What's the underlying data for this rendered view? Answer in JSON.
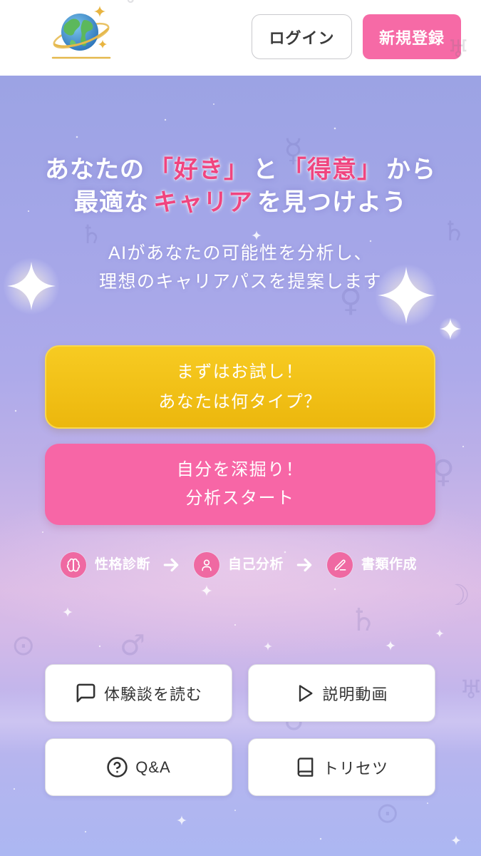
{
  "app": {
    "logo_icon": "globe-planet-logo-icon"
  },
  "header": {
    "login_label": "ログイン",
    "signup_label": "新規登録"
  },
  "hero": {
    "headline": {
      "line1": [
        {
          "text": "あなたの"
        },
        {
          "text": "「好き」"
        },
        {
          "text": "と"
        },
        {
          "text": "「得意」"
        },
        {
          "text": "から"
        }
      ],
      "line2": [
        {
          "text": "最適な"
        },
        {
          "text": "キャリア"
        },
        {
          "text": "を見つけよう"
        }
      ]
    },
    "subtitle": [
      "AIがあなたの可能性を分析し、",
      "理想のキャリアパスを提案します"
    ]
  },
  "cta": {
    "trial": {
      "lines": [
        "まずはお試し！",
        "あなたは何タイプ？"
      ]
    },
    "analysis": {
      "lines": [
        "自分を深掘り！",
        "分析スタート"
      ]
    }
  },
  "steps": [
    {
      "icon": "brain-icon",
      "label": "性格診断"
    },
    {
      "icon": "user-icon",
      "label": "自己分析"
    },
    {
      "icon": "pen-icon",
      "label": "書類作成"
    }
  ],
  "links": [
    {
      "icon": "message-square-icon",
      "label": "体験談を読む"
    },
    {
      "icon": "play-icon",
      "label": "説明動画"
    },
    {
      "icon": "help-circle-icon",
      "label": "Q&A"
    },
    {
      "icon": "book-icon",
      "label": "トリセツ"
    }
  ],
  "colors": {
    "brand_pink": "#f66aa6",
    "cta_yellow": "#f1c21b",
    "highlight_pink": "#f0457f",
    "background_lavender": "#a9a8e8",
    "text_dark": "#333333"
  }
}
